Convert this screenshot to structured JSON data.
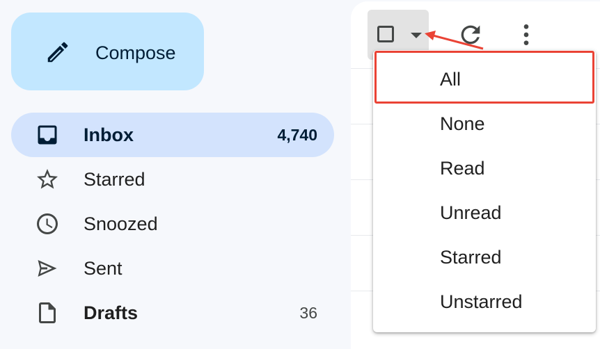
{
  "compose": {
    "label": "Compose",
    "icon": "pencil-icon"
  },
  "sidebar": {
    "items": [
      {
        "label": "Inbox",
        "count": "4,740",
        "icon": "inbox-icon",
        "active": true
      },
      {
        "label": "Starred",
        "count": "",
        "icon": "star-icon"
      },
      {
        "label": "Snoozed",
        "count": "",
        "icon": "clock-icon"
      },
      {
        "label": "Sent",
        "count": "",
        "icon": "send-icon"
      },
      {
        "label": "Drafts",
        "count": "36",
        "icon": "draft-icon"
      }
    ]
  },
  "toolbar": {
    "select_checkbox": "checkbox-icon",
    "select_dropdown": "caret-down-icon",
    "refresh": "refresh-icon",
    "more": "more-vert-icon"
  },
  "select_menu": {
    "items": [
      "All",
      "None",
      "Read",
      "Unread",
      "Starred",
      "Unstarred"
    ],
    "highlighted": "All"
  },
  "colors": {
    "accent": "#c2e7ff",
    "active_nav": "#d3e3fd",
    "annotation": "#ea4335",
    "background": "#f6f8fc"
  }
}
